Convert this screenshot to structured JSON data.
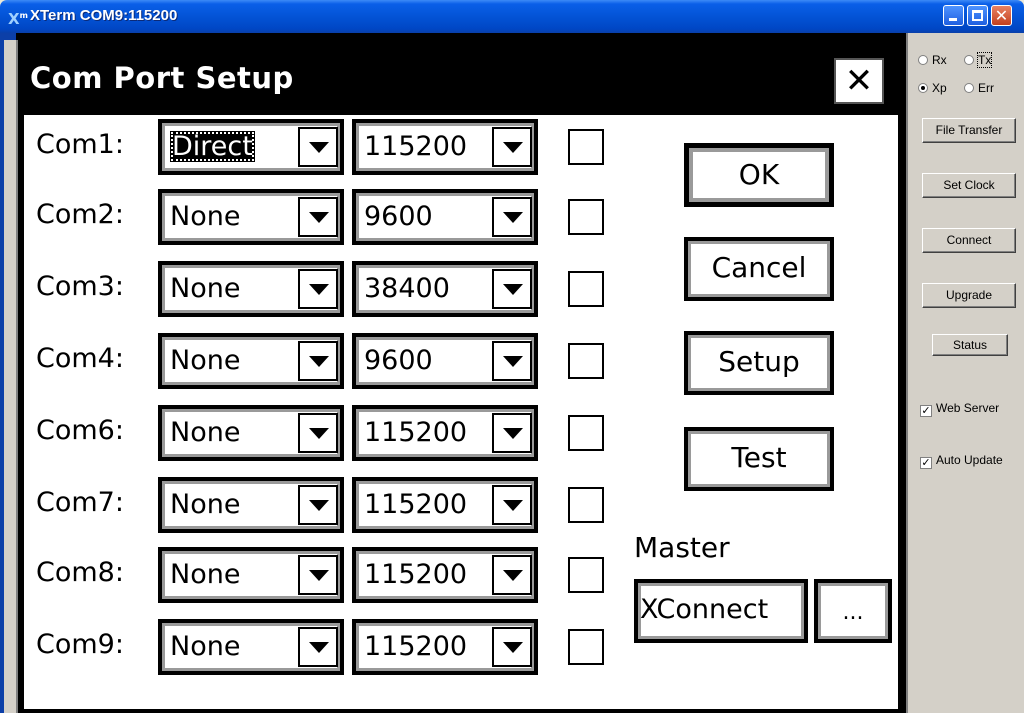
{
  "window": {
    "title": "XTerm COM9:115200",
    "icon_letter": "X",
    "icon_sup": "m",
    "minimize_icon": "minimize-icon",
    "maximize_icon": "maximize-icon",
    "close_glyph": "✕"
  },
  "dialog": {
    "title": "Com Port Setup",
    "close_glyph": "✕",
    "rows": [
      {
        "label": "Com1:",
        "port": "Direct",
        "baud": "115200",
        "checked": false,
        "selected": true
      },
      {
        "label": "Com2:",
        "port": "None",
        "baud": "9600",
        "checked": false
      },
      {
        "label": "Com3:",
        "port": "None",
        "baud": "38400",
        "checked": false
      },
      {
        "label": "Com4:",
        "port": "None",
        "baud": "9600",
        "checked": false
      },
      {
        "label": "Com6:",
        "port": "None",
        "baud": "115200",
        "checked": false
      },
      {
        "label": "Com7:",
        "port": "None",
        "baud": "115200",
        "checked": false
      },
      {
        "label": "Com8:",
        "port": "None",
        "baud": "115200",
        "checked": false
      },
      {
        "label": "Com9:",
        "port": "None",
        "baud": "115200",
        "checked": false
      }
    ],
    "buttons": {
      "ok": "OK",
      "cancel": "Cancel",
      "setup": "Setup",
      "test": "Test"
    },
    "master": {
      "label": "Master",
      "value": "XConnect",
      "browse": "..."
    }
  },
  "side_panel": {
    "radios": {
      "rx": "Rx",
      "tx": "Tx",
      "xp": "Xp",
      "err": "Err",
      "selected": "xp"
    },
    "buttons": {
      "file_transfer": "File Transfer",
      "set_clock": "Set Clock",
      "connect": "Connect",
      "upgrade": "Upgrade",
      "status": "Status"
    },
    "checks": {
      "web_server": "Web Server",
      "auto_update": "Auto Update",
      "check_glyph": "✓"
    }
  }
}
